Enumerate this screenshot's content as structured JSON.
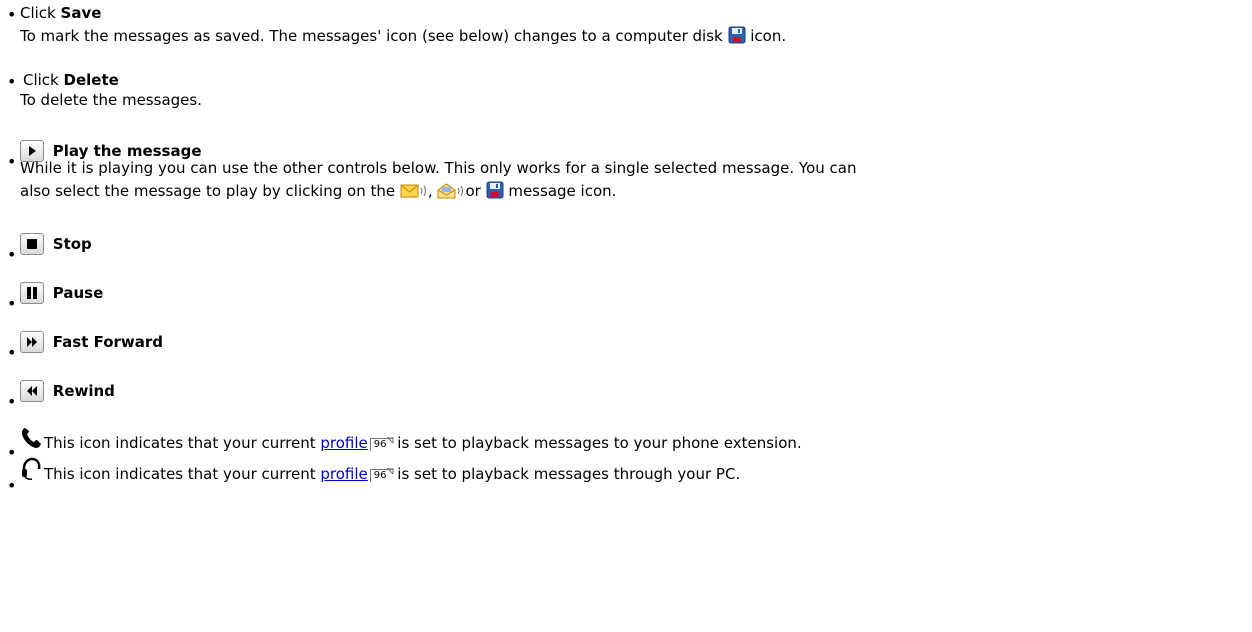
{
  "items": {
    "save": {
      "prefix": "Click ",
      "title": "Save",
      "desc_before": "To mark the messages as saved. The messages' icon (see below) changes to a computer disk",
      "desc_after": " icon."
    },
    "delete": {
      "prefix": "Click ",
      "title": "Delete",
      "desc": "To delete the messages."
    },
    "play": {
      "title": "Play the message",
      "line1": "While it is playing you can use the other controls below. This only works for a single selected message. You can",
      "line2_before": "also select the message to play by clicking on the",
      "sep1": ",",
      "sep2": "or",
      "line2_after": " message icon."
    },
    "stop": {
      "title": "Stop"
    },
    "pause": {
      "title": "Pause"
    },
    "fast_forward": {
      "title": "Fast Forward"
    },
    "rewind": {
      "title": "Rewind"
    },
    "phone": {
      "text_before": "This icon indicates that your current ",
      "link": "profile",
      "page": "96",
      "text_after": " is set to playback messages to your phone extension."
    },
    "headset": {
      "text_before": "This icon indicates that your current ",
      "link": "profile",
      "page": "96",
      "text_after": " is set to playback messages through your PC."
    }
  },
  "icons": {
    "disk": "disk-icon",
    "play": "play-icon",
    "stop": "stop-icon",
    "pause": "pause-icon",
    "fast_forward": "fast-forward-icon",
    "rewind": "rewind-icon",
    "phone": "phone-icon",
    "headset": "headset-icon",
    "new_message": "new-message-icon",
    "read_message": "read-message-icon"
  },
  "colors": {
    "link": "#0000cc",
    "disk": "#2f5fb3"
  }
}
